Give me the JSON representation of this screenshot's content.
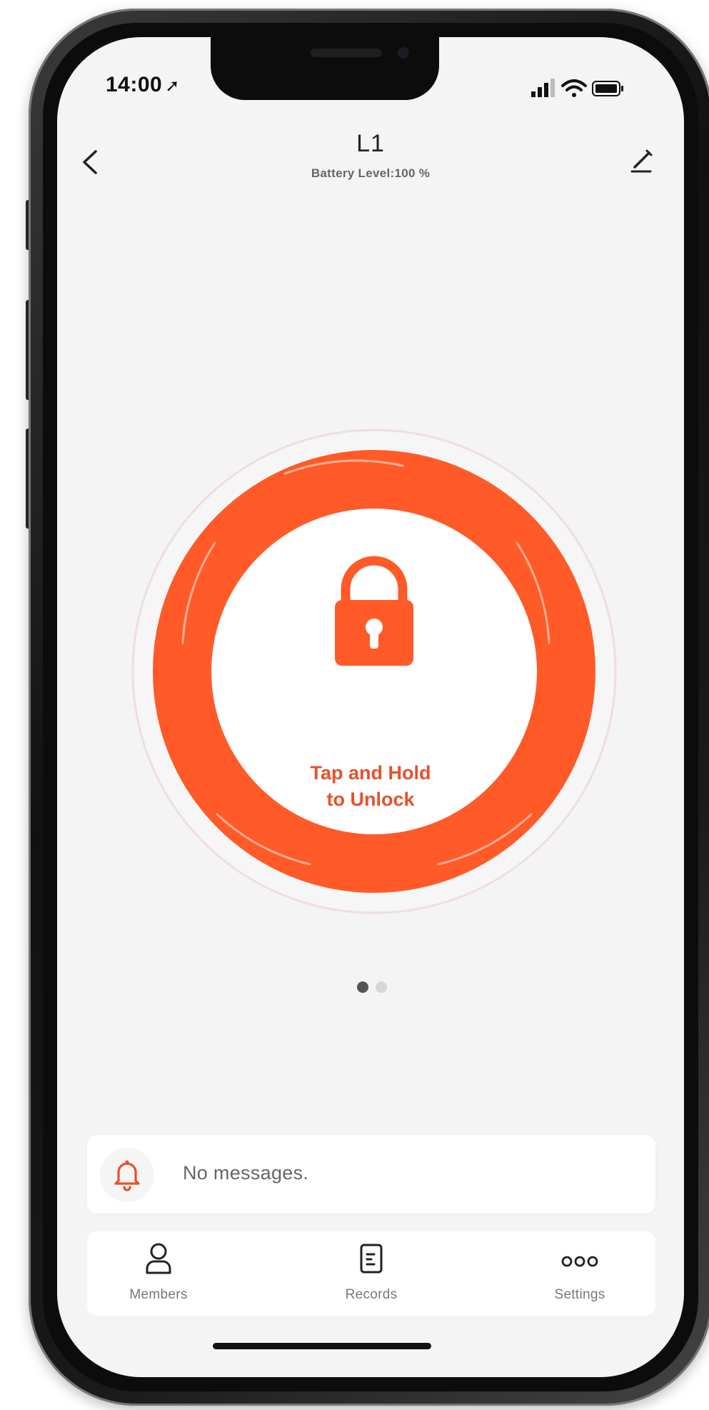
{
  "status_bar": {
    "time": "14:00",
    "location_icon": "location-arrow-icon",
    "icons": [
      "cellular-signal-icon",
      "wifi-icon",
      "battery-icon"
    ]
  },
  "header": {
    "title": "L1",
    "battery_label": "Battery Level:100 %",
    "back_icon": "chevron-left-icon",
    "edit_icon": "pencil-icon"
  },
  "unlock": {
    "line1": "Tap and Hold",
    "line2": "to Unlock",
    "icon": "padlock-icon",
    "accent_color": "#FF5A28",
    "text_color": "#E8502A"
  },
  "pager": {
    "pages": 2,
    "active_index": 0
  },
  "messages": {
    "text": "No messages.",
    "icon": "bell-icon"
  },
  "tabs": [
    {
      "label": "Members",
      "icon": "person-icon"
    },
    {
      "label": "Records",
      "icon": "document-icon"
    },
    {
      "label": "Settings",
      "icon": "more-dots-icon"
    }
  ]
}
